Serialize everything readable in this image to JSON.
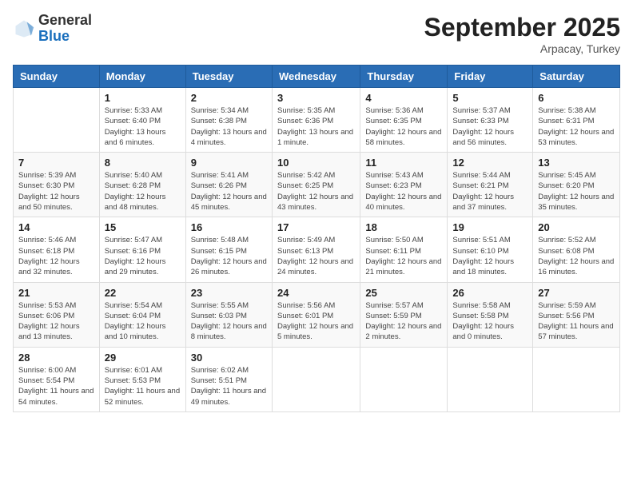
{
  "header": {
    "logo_general": "General",
    "logo_blue": "Blue",
    "month": "September 2025",
    "location": "Arpacay, Turkey"
  },
  "days_of_week": [
    "Sunday",
    "Monday",
    "Tuesday",
    "Wednesday",
    "Thursday",
    "Friday",
    "Saturday"
  ],
  "weeks": [
    [
      {
        "day": "",
        "sunrise": "",
        "sunset": "",
        "daylight": ""
      },
      {
        "day": "1",
        "sunrise": "Sunrise: 5:33 AM",
        "sunset": "Sunset: 6:40 PM",
        "daylight": "Daylight: 13 hours and 6 minutes."
      },
      {
        "day": "2",
        "sunrise": "Sunrise: 5:34 AM",
        "sunset": "Sunset: 6:38 PM",
        "daylight": "Daylight: 13 hours and 4 minutes."
      },
      {
        "day": "3",
        "sunrise": "Sunrise: 5:35 AM",
        "sunset": "Sunset: 6:36 PM",
        "daylight": "Daylight: 13 hours and 1 minute."
      },
      {
        "day": "4",
        "sunrise": "Sunrise: 5:36 AM",
        "sunset": "Sunset: 6:35 PM",
        "daylight": "Daylight: 12 hours and 58 minutes."
      },
      {
        "day": "5",
        "sunrise": "Sunrise: 5:37 AM",
        "sunset": "Sunset: 6:33 PM",
        "daylight": "Daylight: 12 hours and 56 minutes."
      },
      {
        "day": "6",
        "sunrise": "Sunrise: 5:38 AM",
        "sunset": "Sunset: 6:31 PM",
        "daylight": "Daylight: 12 hours and 53 minutes."
      }
    ],
    [
      {
        "day": "7",
        "sunrise": "Sunrise: 5:39 AM",
        "sunset": "Sunset: 6:30 PM",
        "daylight": "Daylight: 12 hours and 50 minutes."
      },
      {
        "day": "8",
        "sunrise": "Sunrise: 5:40 AM",
        "sunset": "Sunset: 6:28 PM",
        "daylight": "Daylight: 12 hours and 48 minutes."
      },
      {
        "day": "9",
        "sunrise": "Sunrise: 5:41 AM",
        "sunset": "Sunset: 6:26 PM",
        "daylight": "Daylight: 12 hours and 45 minutes."
      },
      {
        "day": "10",
        "sunrise": "Sunrise: 5:42 AM",
        "sunset": "Sunset: 6:25 PM",
        "daylight": "Daylight: 12 hours and 43 minutes."
      },
      {
        "day": "11",
        "sunrise": "Sunrise: 5:43 AM",
        "sunset": "Sunset: 6:23 PM",
        "daylight": "Daylight: 12 hours and 40 minutes."
      },
      {
        "day": "12",
        "sunrise": "Sunrise: 5:44 AM",
        "sunset": "Sunset: 6:21 PM",
        "daylight": "Daylight: 12 hours and 37 minutes."
      },
      {
        "day": "13",
        "sunrise": "Sunrise: 5:45 AM",
        "sunset": "Sunset: 6:20 PM",
        "daylight": "Daylight: 12 hours and 35 minutes."
      }
    ],
    [
      {
        "day": "14",
        "sunrise": "Sunrise: 5:46 AM",
        "sunset": "Sunset: 6:18 PM",
        "daylight": "Daylight: 12 hours and 32 minutes."
      },
      {
        "day": "15",
        "sunrise": "Sunrise: 5:47 AM",
        "sunset": "Sunset: 6:16 PM",
        "daylight": "Daylight: 12 hours and 29 minutes."
      },
      {
        "day": "16",
        "sunrise": "Sunrise: 5:48 AM",
        "sunset": "Sunset: 6:15 PM",
        "daylight": "Daylight: 12 hours and 26 minutes."
      },
      {
        "day": "17",
        "sunrise": "Sunrise: 5:49 AM",
        "sunset": "Sunset: 6:13 PM",
        "daylight": "Daylight: 12 hours and 24 minutes."
      },
      {
        "day": "18",
        "sunrise": "Sunrise: 5:50 AM",
        "sunset": "Sunset: 6:11 PM",
        "daylight": "Daylight: 12 hours and 21 minutes."
      },
      {
        "day": "19",
        "sunrise": "Sunrise: 5:51 AM",
        "sunset": "Sunset: 6:10 PM",
        "daylight": "Daylight: 12 hours and 18 minutes."
      },
      {
        "day": "20",
        "sunrise": "Sunrise: 5:52 AM",
        "sunset": "Sunset: 6:08 PM",
        "daylight": "Daylight: 12 hours and 16 minutes."
      }
    ],
    [
      {
        "day": "21",
        "sunrise": "Sunrise: 5:53 AM",
        "sunset": "Sunset: 6:06 PM",
        "daylight": "Daylight: 12 hours and 13 minutes."
      },
      {
        "day": "22",
        "sunrise": "Sunrise: 5:54 AM",
        "sunset": "Sunset: 6:04 PM",
        "daylight": "Daylight: 12 hours and 10 minutes."
      },
      {
        "day": "23",
        "sunrise": "Sunrise: 5:55 AM",
        "sunset": "Sunset: 6:03 PM",
        "daylight": "Daylight: 12 hours and 8 minutes."
      },
      {
        "day": "24",
        "sunrise": "Sunrise: 5:56 AM",
        "sunset": "Sunset: 6:01 PM",
        "daylight": "Daylight: 12 hours and 5 minutes."
      },
      {
        "day": "25",
        "sunrise": "Sunrise: 5:57 AM",
        "sunset": "Sunset: 5:59 PM",
        "daylight": "Daylight: 12 hours and 2 minutes."
      },
      {
        "day": "26",
        "sunrise": "Sunrise: 5:58 AM",
        "sunset": "Sunset: 5:58 PM",
        "daylight": "Daylight: 12 hours and 0 minutes."
      },
      {
        "day": "27",
        "sunrise": "Sunrise: 5:59 AM",
        "sunset": "Sunset: 5:56 PM",
        "daylight": "Daylight: 11 hours and 57 minutes."
      }
    ],
    [
      {
        "day": "28",
        "sunrise": "Sunrise: 6:00 AM",
        "sunset": "Sunset: 5:54 PM",
        "daylight": "Daylight: 11 hours and 54 minutes."
      },
      {
        "day": "29",
        "sunrise": "Sunrise: 6:01 AM",
        "sunset": "Sunset: 5:53 PM",
        "daylight": "Daylight: 11 hours and 52 minutes."
      },
      {
        "day": "30",
        "sunrise": "Sunrise: 6:02 AM",
        "sunset": "Sunset: 5:51 PM",
        "daylight": "Daylight: 11 hours and 49 minutes."
      },
      {
        "day": "",
        "sunrise": "",
        "sunset": "",
        "daylight": ""
      },
      {
        "day": "",
        "sunrise": "",
        "sunset": "",
        "daylight": ""
      },
      {
        "day": "",
        "sunrise": "",
        "sunset": "",
        "daylight": ""
      },
      {
        "day": "",
        "sunrise": "",
        "sunset": "",
        "daylight": ""
      }
    ]
  ]
}
